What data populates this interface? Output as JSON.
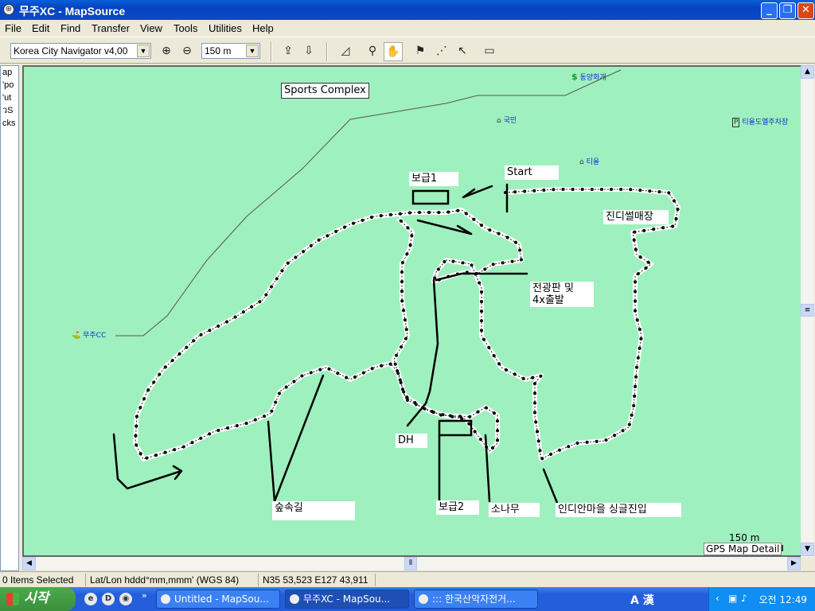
{
  "window": {
    "title": "무주XC - MapSource",
    "icon": "mapsource-icon"
  },
  "menu": [
    "File",
    "Edit",
    "Find",
    "Transfer",
    "View",
    "Tools",
    "Utilities",
    "Help"
  ],
  "toolbar": {
    "map_product": "Korea City Navigator v4,00",
    "zoom_scale": "150 m"
  },
  "left_pane": {
    "rows": [
      "ap",
      "'po",
      "'ut",
      "วS",
      "cks"
    ]
  },
  "map": {
    "labels": {
      "sports_complex": "Sports Complex",
      "start": "Start",
      "supply1": "보급1",
      "diesel_shop": "진디썰매장",
      "display_board": "전광판 및",
      "display_board2": "4x출발",
      "dh": "DH",
      "supply2": "보급2",
      "forest_road": "숲속길",
      "pine": "소나무",
      "indian_village": "인디안마을 싱글진입"
    },
    "pois": {
      "poi_top": "동양화개",
      "poi_gukmin": "국민",
      "poi_tiol": "티올",
      "poi_parking": "티올도엘주차장",
      "poi_muju_cc": "무주CC"
    },
    "scale_label": "150 m",
    "detail_label": "GPS Map Detail"
  },
  "status": {
    "selected": "0 Items Selected",
    "format": "Lat/Lon hddd°mm,mmm' (WGS 84)",
    "coords": "N35 53,523 E127 43,911"
  },
  "taskbar": {
    "start_label": "시작",
    "tasks": [
      "Untitled - MapSou...",
      "무주XC - MapSou...",
      "::: 한국산악자전거..."
    ],
    "tray_text": "A 漢",
    "clock": "오전 12:49"
  }
}
